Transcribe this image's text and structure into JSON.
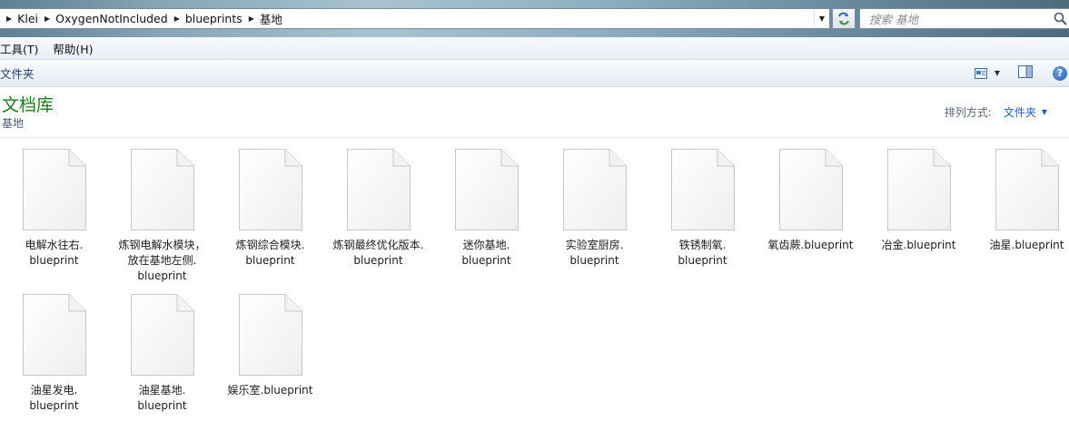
{
  "address_bar": {
    "breadcrumbs": [
      "Klei",
      "OxygenNotIncluded",
      "blueprints",
      "基地"
    ]
  },
  "search": {
    "placeholder": "搜索 基地"
  },
  "menu": {
    "items": [
      "工具(T)",
      "帮助(H)"
    ]
  },
  "command_bar": {
    "folder_label": "文件夹"
  },
  "library": {
    "title": "文档库",
    "subtitle": "基地"
  },
  "sort": {
    "label": "排列方式:",
    "value": "文件夹"
  },
  "files": [
    {
      "lines": [
        "电解水往右.",
        "blueprint"
      ]
    },
    {
      "lines": [
        "炼钢电解水模块，",
        "放在基地左侧.",
        "blueprint"
      ]
    },
    {
      "lines": [
        "炼钢综合模块.",
        "blueprint"
      ]
    },
    {
      "lines": [
        "炼钢最终优化版本.",
        "blueprint"
      ]
    },
    {
      "lines": [
        "迷你基地.",
        "blueprint"
      ]
    },
    {
      "lines": [
        "实验室厨房.",
        "blueprint"
      ]
    },
    {
      "lines": [
        "铁锈制氧.",
        "blueprint"
      ]
    },
    {
      "lines": [
        "氧齿蕨.blueprint"
      ]
    },
    {
      "lines": [
        "冶金.blueprint"
      ]
    },
    {
      "lines": [
        "油星.blueprint"
      ]
    },
    {
      "lines": [
        "油星发电.",
        "blueprint"
      ]
    },
    {
      "lines": [
        "油星基地.",
        "blueprint"
      ]
    },
    {
      "lines": [
        "娱乐室.blueprint"
      ]
    }
  ],
  "icons": {
    "breadcrumb_arrow": "chevron-right-icon",
    "address_dropdown": "chevron-down-icon",
    "refresh": "refresh-icon",
    "search": "search-icon",
    "view": "change-view-icon",
    "preview_pane": "preview-pane-icon",
    "help": "help-icon",
    "file": "blank-document-icon"
  },
  "colors": {
    "library_title": "#1e7a1e",
    "sort_value": "#1e5eb8"
  }
}
